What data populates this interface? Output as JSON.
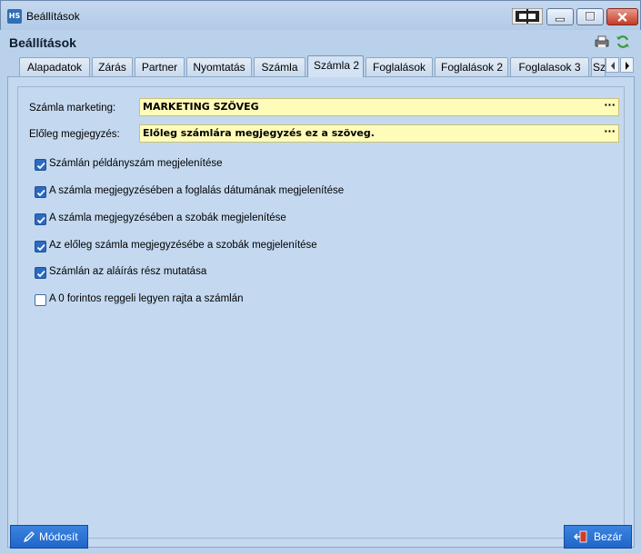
{
  "window": {
    "title": "Beállítások",
    "app_icon_text": "HS"
  },
  "header": {
    "title": "Beállítások"
  },
  "tabs": [
    {
      "label": "Alapadatok"
    },
    {
      "label": "Zárás"
    },
    {
      "label": "Partner"
    },
    {
      "label": "Nyomtatás"
    },
    {
      "label": "Számla"
    },
    {
      "label": "Számla 2",
      "active": true
    },
    {
      "label": "Foglalások"
    },
    {
      "label": "Foglalások 2"
    },
    {
      "label": "Foglalasok 3"
    },
    {
      "label": "Sz"
    }
  ],
  "fields": {
    "marketing_label": "Számla marketing:",
    "marketing_value": "MARKETING SZÖVEG",
    "advance_label": "Előleg megjegyzés:",
    "advance_value": "Előleg számlára megjegyzés ez a szöveg.",
    "ellipsis": "···"
  },
  "checkboxes": [
    {
      "label": "Számlán példányszám megjelenítése",
      "checked": true
    },
    {
      "label": "A számla megjegyzésében a foglalás dátumának megjelenítése",
      "checked": true
    },
    {
      "label": "A számla megjegyzésében a szobák megjelenítése",
      "checked": true
    },
    {
      "label": "Az előleg számla megjegyzésébe a szobák megjelenítése",
      "checked": true
    },
    {
      "label": "Számlán az aláírás rész mutatása",
      "checked": true
    },
    {
      "label": "A 0 forintos reggeli legyen rajta a számlán",
      "checked": false
    }
  ],
  "buttons": {
    "modify_label": "Módosít",
    "close_label": "Bezár"
  },
  "colors": {
    "accent": "#2c76d6",
    "input_bg": "#fffbb8",
    "panel_bg": "#c4d9f0"
  }
}
